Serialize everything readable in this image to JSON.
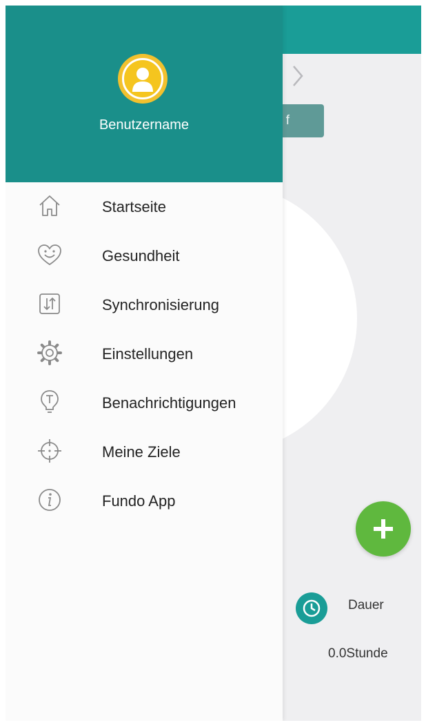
{
  "background": {
    "button_label": "f",
    "summary": {
      "label": "Dauer",
      "value": "0.0Stunde",
      "icon": "clock-icon"
    }
  },
  "drawer": {
    "username": "Benutzername",
    "avatar_icon": "user-icon",
    "items": [
      {
        "label": "Startseite",
        "icon": "home-icon"
      },
      {
        "label": "Gesundheit",
        "icon": "heart-smile-icon"
      },
      {
        "label": "Synchronisierung",
        "icon": "sync-icon"
      },
      {
        "label": "Einstellungen",
        "icon": "gear-icon"
      },
      {
        "label": "Benachrichtigungen",
        "icon": "bulb-icon"
      },
      {
        "label": "Meine Ziele",
        "icon": "target-icon"
      },
      {
        "label": "Fundo App",
        "icon": "info-icon"
      }
    ]
  },
  "colors": {
    "header_teal": "#1a8f8a",
    "app_bar_teal": "#1a9d97",
    "avatar_yellow": "#f2c12e",
    "fab_green": "#5fb83e"
  }
}
